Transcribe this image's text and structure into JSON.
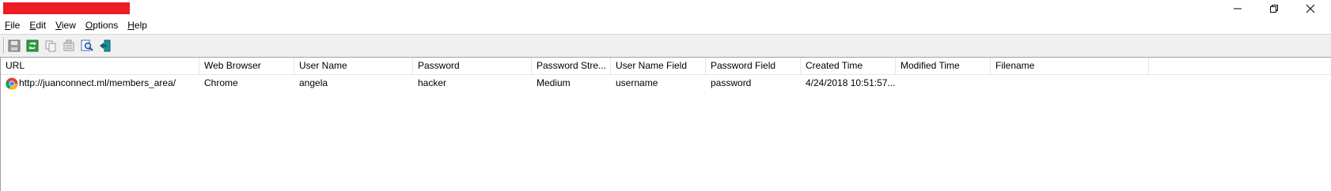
{
  "window": {
    "controls": {
      "minimize_icon": "minimize-icon",
      "restore_icon": "restore-icon",
      "close_icon": "close-icon"
    }
  },
  "menu": [
    "File",
    "Edit",
    "View",
    "Options",
    "Help"
  ],
  "menu_accel": [
    "F",
    "E",
    "V",
    "O",
    "H"
  ],
  "toolbar": {
    "buttons": [
      "save-icon",
      "refresh-icon",
      "copy-icon",
      "properties-icon",
      "find-icon",
      "exit-icon"
    ]
  },
  "table": {
    "columns": [
      "URL",
      "Web Browser",
      "User Name",
      "Password",
      "Password Stre...",
      "User Name Field",
      "Password Field",
      "Created Time",
      "Modified Time",
      "Filename"
    ],
    "rows": [
      {
        "icon": "chrome-icon",
        "cells": [
          "http://juanconnect.ml/members_area/",
          "Chrome",
          "angela",
          "hacker",
          "Medium",
          "username",
          "password",
          "4/24/2018 10:51:57...",
          "",
          ""
        ]
      }
    ]
  },
  "colors": {
    "redaction": "#ed1c24",
    "toolbar_bg": "#f0f0f0"
  }
}
